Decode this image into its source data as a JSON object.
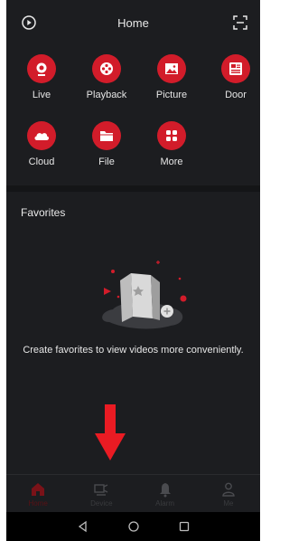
{
  "header": {
    "title": "Home",
    "left_icon": "playback-history-icon",
    "right_icon": "scan-icon"
  },
  "grid": [
    {
      "label": "Live",
      "icon": "camera-icon"
    },
    {
      "label": "Playback",
      "icon": "film-reel-icon"
    },
    {
      "label": "Picture",
      "icon": "picture-icon"
    },
    {
      "label": "Door",
      "icon": "door-intercom-icon"
    },
    {
      "label": "Cloud",
      "icon": "cloud-icon"
    },
    {
      "label": "File",
      "icon": "folder-icon"
    },
    {
      "label": "More",
      "icon": "grid-dots-icon"
    }
  ],
  "favorites": {
    "title": "Favorites",
    "empty_message": "Create favorites to view videos more conveniently."
  },
  "tabbar": [
    {
      "label": "Home",
      "icon": "home-icon",
      "active": true
    },
    {
      "label": "Device",
      "icon": "device-icon",
      "active": false
    },
    {
      "label": "Alarm",
      "icon": "bell-icon",
      "active": false
    },
    {
      "label": "Me",
      "icon": "person-icon",
      "active": false
    }
  ],
  "colors": {
    "accent": "#d21c2a",
    "background": "#1c1d20",
    "text": "#e9e9e9"
  }
}
